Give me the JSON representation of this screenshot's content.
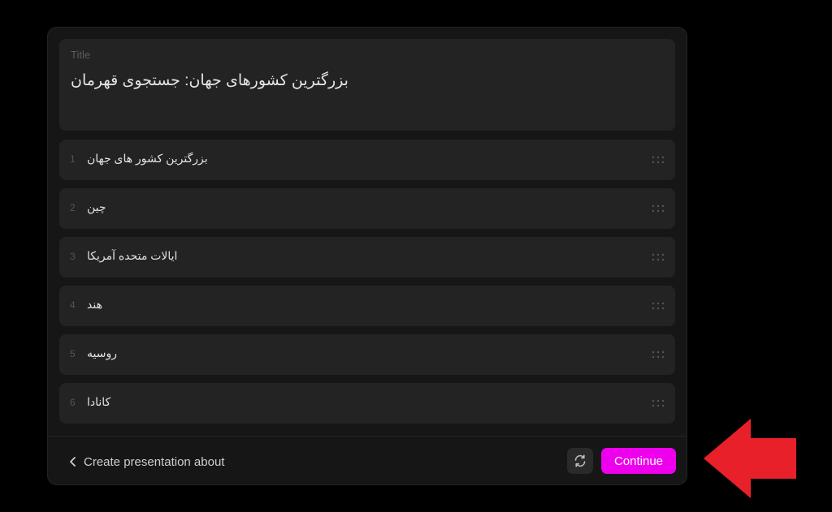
{
  "title_section": {
    "label": "Title",
    "value": "بزرگترین کشورهای جهان: جستجوی قهرمان"
  },
  "outline": {
    "items": [
      {
        "number": "1",
        "text": "بزرگترین کشور های جهان"
      },
      {
        "number": "2",
        "text": "چین"
      },
      {
        "number": "3",
        "text": "ایالات متحده آمریکا"
      },
      {
        "number": "4",
        "text": "هند"
      },
      {
        "number": "5",
        "text": "روسیه"
      },
      {
        "number": "6",
        "text": "کانادا"
      }
    ]
  },
  "footer": {
    "back_label": "Create presentation about",
    "continue_label": "Continue",
    "refresh_icon": "refresh-icon"
  },
  "colors": {
    "accent": "#ee00ee",
    "annotation_arrow": "#e8202a",
    "panel": "#161616",
    "card": "#232323"
  }
}
